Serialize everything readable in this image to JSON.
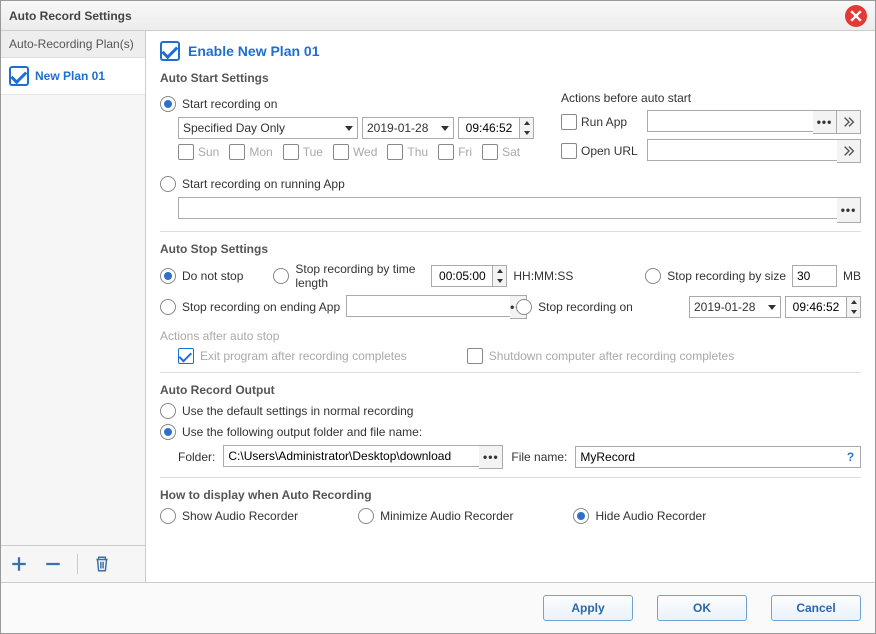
{
  "window": {
    "title": "Auto Record Settings"
  },
  "sidebar": {
    "header": "Auto-Recording Plan(s)",
    "plans": [
      {
        "label": "New Plan 01",
        "checked": true
      }
    ]
  },
  "enable": {
    "label": "Enable New Plan 01",
    "checked": true
  },
  "autoStart": {
    "title": "Auto Start Settings",
    "startOnLabel": "Start recording on",
    "mode": "Specified Day Only",
    "date": "2019-01-28",
    "time": "09:46:52",
    "days": [
      "Sun",
      "Mon",
      "Tue",
      "Wed",
      "Thu",
      "Fri",
      "Sat"
    ],
    "startOnAppLabel": "Start recording on running App",
    "runningAppPath": "",
    "actionsTitle": "Actions before auto start",
    "runAppLabel": "Run App",
    "runAppValue": "",
    "openUrlLabel": "Open URL",
    "openUrlValue": ""
  },
  "autoStop": {
    "title": "Auto Stop Settings",
    "doNotStopLabel": "Do not stop",
    "byTimeLabel": "Stop recording by time length",
    "timeLengthValue": "00:05:00",
    "timeUnit": "HH:MM:SS",
    "bySizeLabel": "Stop recording by size",
    "sizeValue": "30",
    "sizeUnit": "MB",
    "onEndingAppLabel": "Stop recording on ending App",
    "endingAppValue": "",
    "stopOnLabel": "Stop recording on",
    "stopDate": "2019-01-28",
    "stopTime": "09:46:52",
    "actionsAfterTitle": "Actions after auto stop",
    "exitProgramLabel": "Exit program after recording completes",
    "shutdownLabel": "Shutdown computer after recording completes"
  },
  "output": {
    "title": "Auto Record Output",
    "useDefaultLabel": "Use the default settings in normal recording",
    "useCustomLabel": "Use the following output folder and file name:",
    "folderLabel": "Folder:",
    "folderValue": "C:\\Users\\Administrator\\Desktop\\download",
    "fileNameLabel": "File name:",
    "fileNameValue": "MyRecord"
  },
  "display": {
    "title": "How to display when Auto Recording",
    "showLabel": "Show Audio Recorder",
    "minimizeLabel": "Minimize Audio Recorder",
    "hideLabel": "Hide Audio Recorder"
  },
  "footer": {
    "apply": "Apply",
    "ok": "OK",
    "cancel": "Cancel"
  }
}
